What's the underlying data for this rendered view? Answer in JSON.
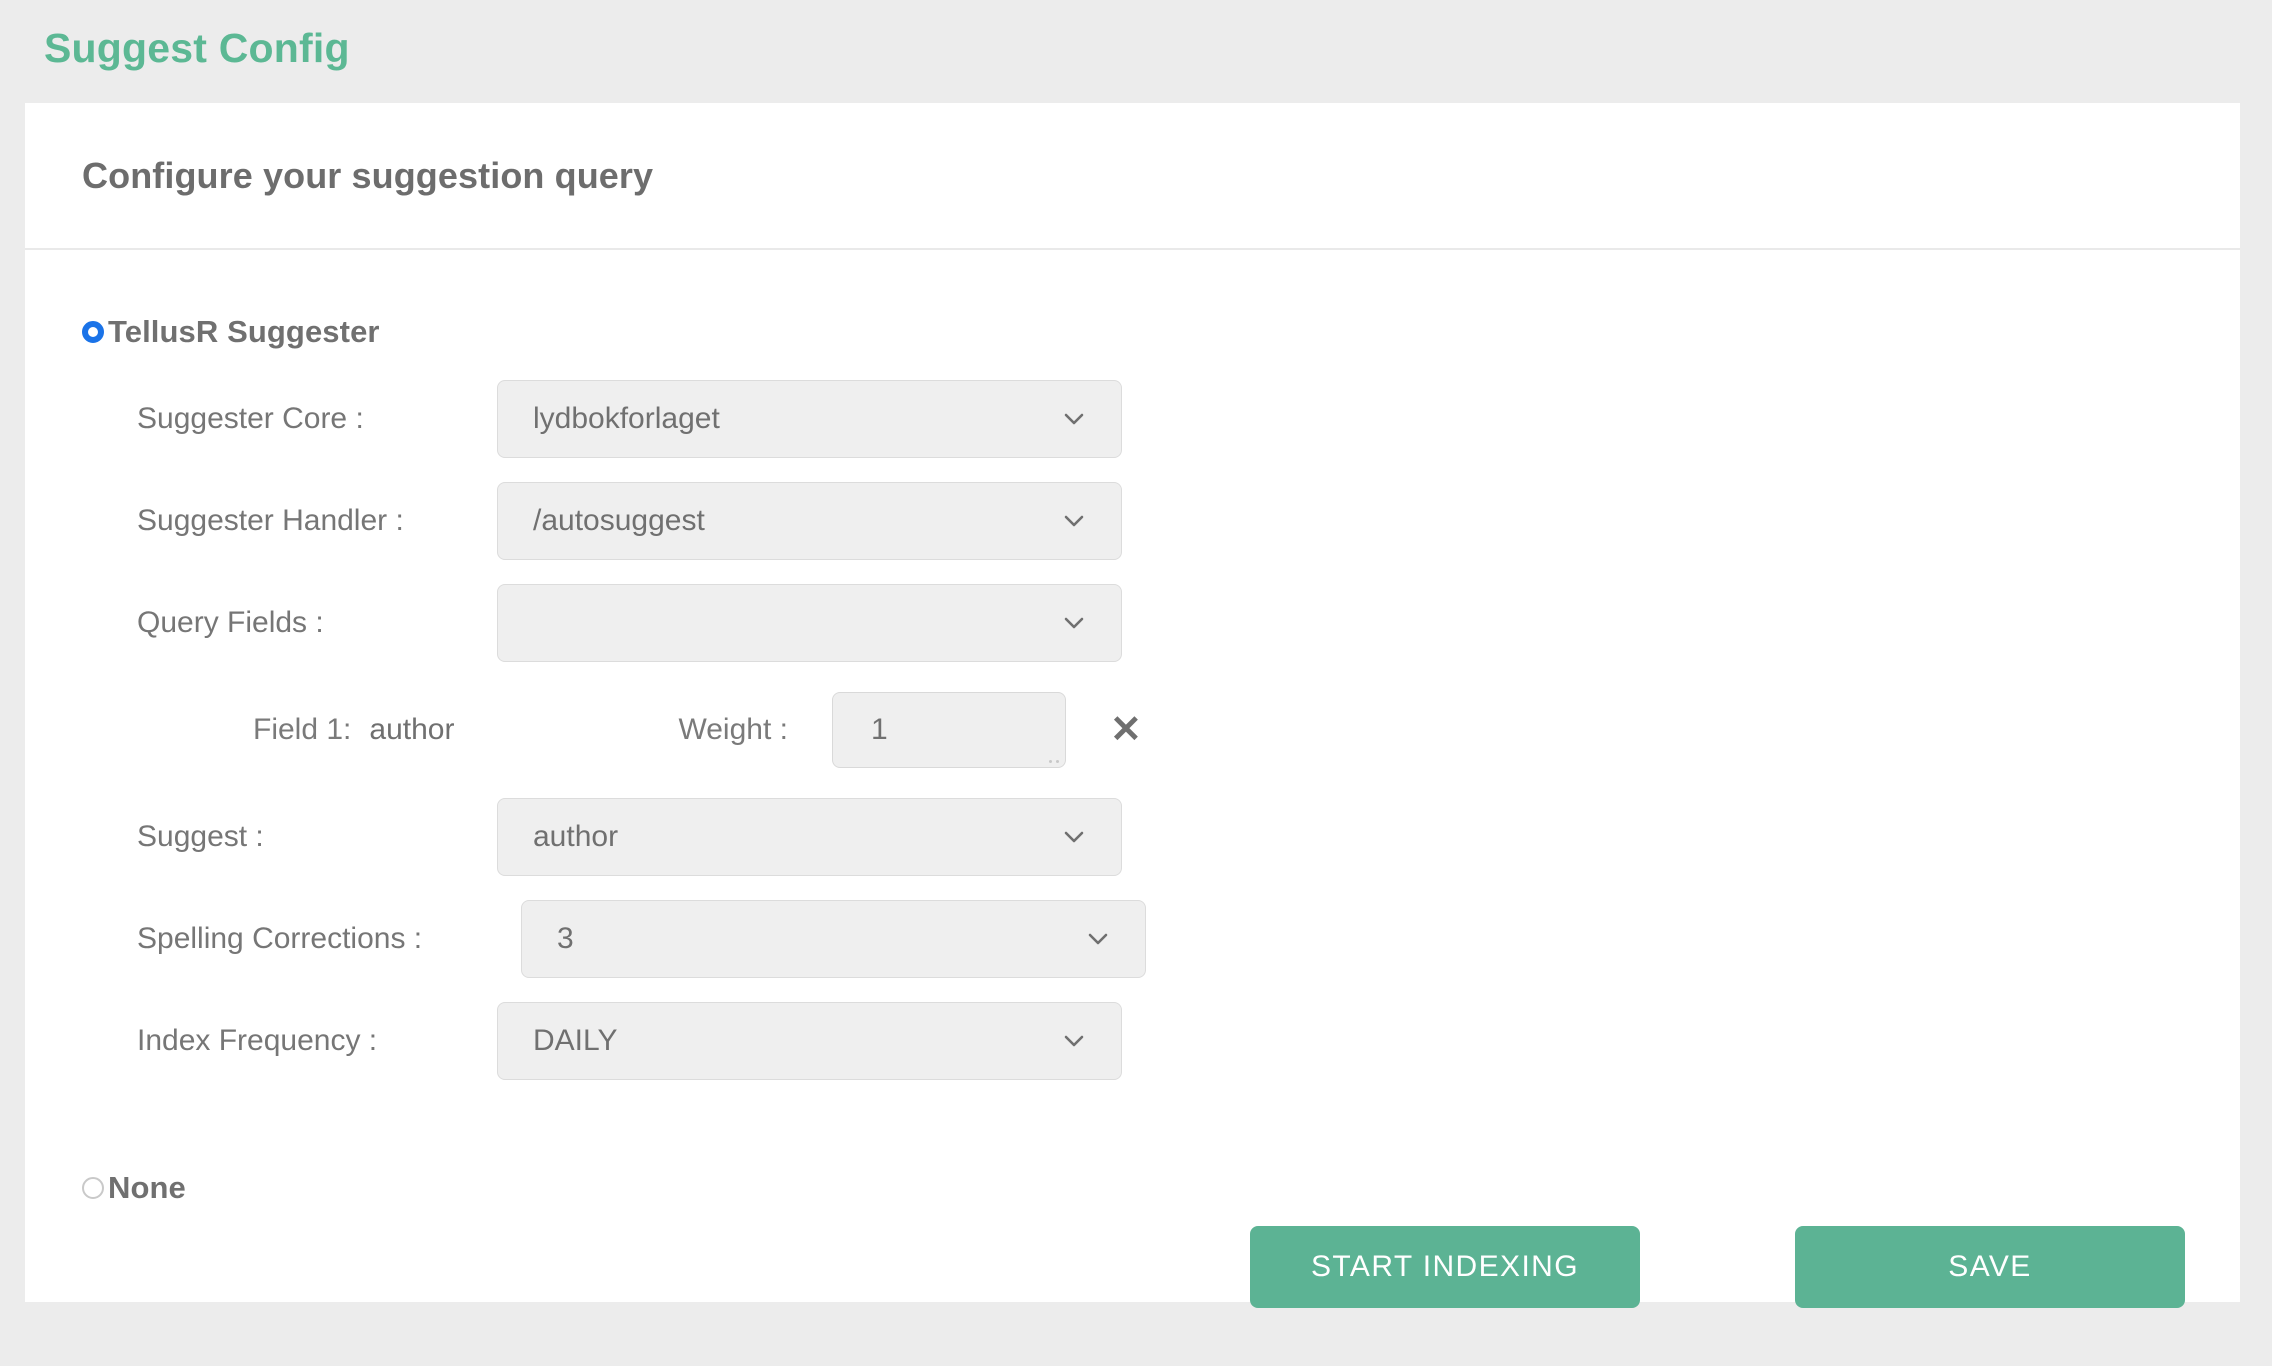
{
  "page": {
    "title": "Suggest Config",
    "title_color": "#5cb894",
    "background_color": "#ececec"
  },
  "card": {
    "header_title": "Configure your suggestion query",
    "background_color": "#ffffff"
  },
  "options": {
    "tellusr": {
      "label": "TellusR Suggester",
      "selected": true,
      "radio_color": "#1a73e8"
    },
    "none": {
      "label": "None",
      "selected": false
    }
  },
  "form": {
    "rows": [
      {
        "label": "Suggester Core :",
        "value": "lydbokforlaget",
        "icon": "chevron-down-icon"
      },
      {
        "label": "Suggester Handler :",
        "value": "/autosuggest",
        "icon": "chevron-down-icon"
      },
      {
        "label": "Query Fields :",
        "value": "",
        "icon": "chevron-down-icon"
      },
      {
        "label": "Suggest :",
        "value": "author",
        "icon": "chevron-down-icon"
      },
      {
        "label": "Spelling Corrections :",
        "value": "3",
        "icon": "chevron-down-icon"
      },
      {
        "label": "Index Frequency :",
        "value": "DAILY",
        "icon": "chevron-down-icon"
      }
    ],
    "field_detail": {
      "field_label": "Field 1:",
      "field_name": "author",
      "weight_label": "Weight :",
      "weight_value": "1",
      "remove_icon": "✕"
    }
  },
  "buttons": {
    "start_indexing": "START INDEXING",
    "save": "SAVE",
    "color": "#5cb394"
  }
}
